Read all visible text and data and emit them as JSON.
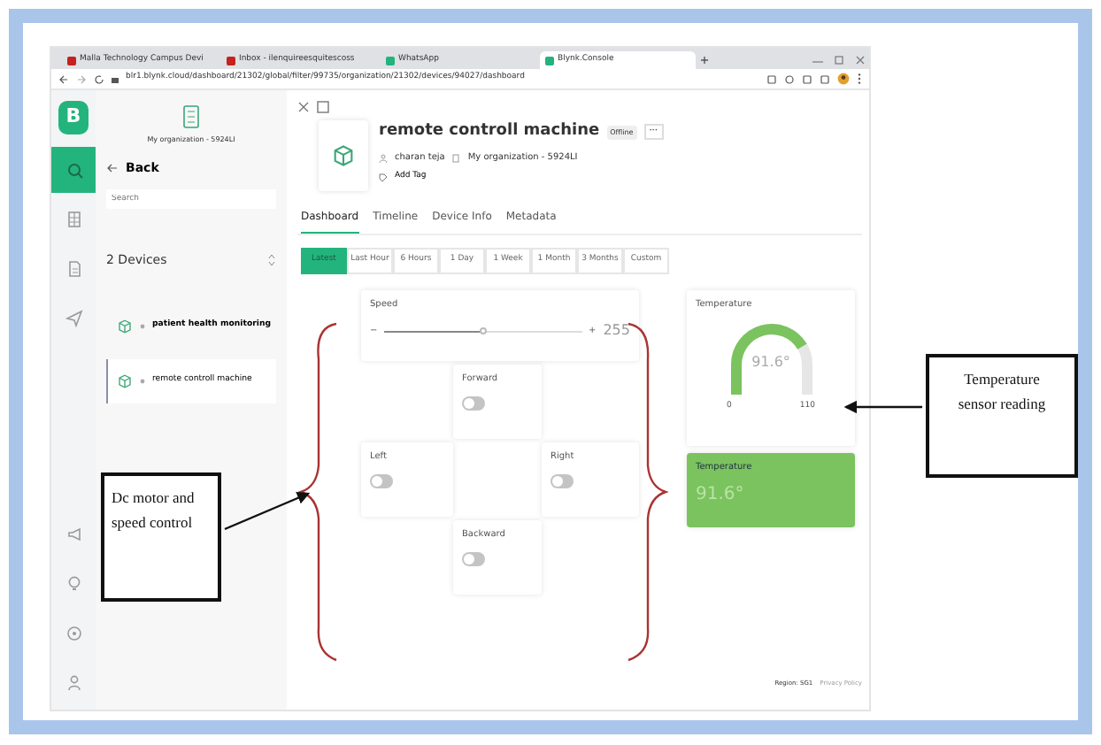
{
  "browser": {
    "tabs": [
      {
        "label": "Malla Technology Campus Devi",
        "selected": false
      },
      {
        "label": "Inbox - ilenquireesquitescoss",
        "selected": false
      },
      {
        "label": "WhatsApp",
        "selected": false
      },
      {
        "label": "Blynk.Console",
        "selected": true
      }
    ],
    "url": "blr1.blynk.cloud/dashboard/21302/global/filter/99735/organization/21302/devices/94027/dashboard"
  },
  "rail": {
    "logo": "B",
    "items": [
      {
        "kind": "search",
        "selected": true
      },
      {
        "kind": "table",
        "selected": false
      },
      {
        "kind": "document",
        "selected": false
      },
      {
        "kind": "send",
        "selected": false
      },
      {
        "kind": "megaphone",
        "selected": false
      },
      {
        "kind": "bulb",
        "selected": false
      },
      {
        "kind": "compass",
        "selected": false
      },
      {
        "kind": "user",
        "selected": false
      }
    ]
  },
  "sidebar": {
    "organization": "My organization - 5924LI",
    "back": "Back",
    "search": {
      "placeholder": "Search"
    },
    "device_count": "2 Devices",
    "devices": [
      {
        "name": "patient health monitoring",
        "selected": false
      },
      {
        "name": "remote controll machine",
        "selected": true
      }
    ]
  },
  "device": {
    "name": "remote controll machine",
    "status": "Offline",
    "more": "···",
    "owner": "charan teja",
    "organization": "My organization - 5924LI",
    "add_tag": "Add Tag"
  },
  "tabs": [
    {
      "label": "Dashboard",
      "selected": true
    },
    {
      "label": "Timeline",
      "selected": false
    },
    {
      "label": "Device Info",
      "selected": false
    },
    {
      "label": "Metadata",
      "selected": false
    }
  ],
  "ranges": [
    {
      "label": "Latest",
      "selected": true
    },
    {
      "label": "Last Hour",
      "selected": false
    },
    {
      "label": "6 Hours",
      "selected": false
    },
    {
      "label": "1 Day",
      "selected": false
    },
    {
      "label": "1 Week",
      "selected": false
    },
    {
      "label": "1 Month",
      "selected": false
    },
    {
      "label": "3 Months",
      "selected": false
    },
    {
      "label": "Custom",
      "selected": false
    }
  ],
  "speed": {
    "label": "Speed",
    "minus": "−",
    "plus": "+",
    "value": "255",
    "level": 0.5
  },
  "switches": [
    {
      "label": "Forward",
      "on": false
    },
    {
      "label": "Left",
      "on": false
    },
    {
      "label": "Right",
      "on": false
    },
    {
      "label": "Backward",
      "on": false
    }
  ],
  "gauge": {
    "label": "Temperature",
    "value": "91.6°",
    "min": "0",
    "max": "110"
  },
  "value_widget": {
    "label": "Temperature",
    "value": "91.6°"
  },
  "footer": {
    "region": "Region: SG1",
    "privacy": "Privacy Policy"
  },
  "annotations": [
    {
      "text": "Dc motor and speed control"
    },
    {
      "text": "Temperature sensor reading"
    }
  ]
}
